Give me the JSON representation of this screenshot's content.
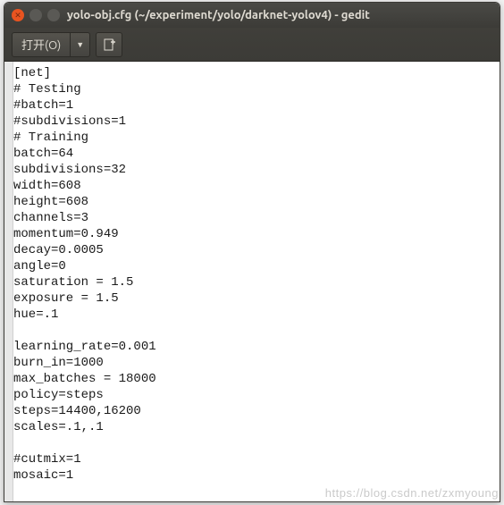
{
  "window": {
    "title": "yolo-obj.cfg (~/experiment/yolo/darknet-yolov4) - gedit"
  },
  "toolbar": {
    "open_label": "打开(O)",
    "open_arrow": "▼"
  },
  "editor": {
    "lines": [
      "[net]",
      "# Testing",
      "#batch=1",
      "#subdivisions=1",
      "# Training",
      "batch=64",
      "subdivisions=32",
      "width=608",
      "height=608",
      "channels=3",
      "momentum=0.949",
      "decay=0.0005",
      "angle=0",
      "saturation = 1.5",
      "exposure = 1.5",
      "hue=.1",
      "",
      "learning_rate=0.001",
      "burn_in=1000",
      "max_batches = 18000",
      "policy=steps",
      "steps=14400,16200",
      "scales=.1,.1",
      "",
      "#cutmix=1",
      "mosaic=1"
    ]
  },
  "watermark": "https://blog.csdn.net/zxmyoung"
}
